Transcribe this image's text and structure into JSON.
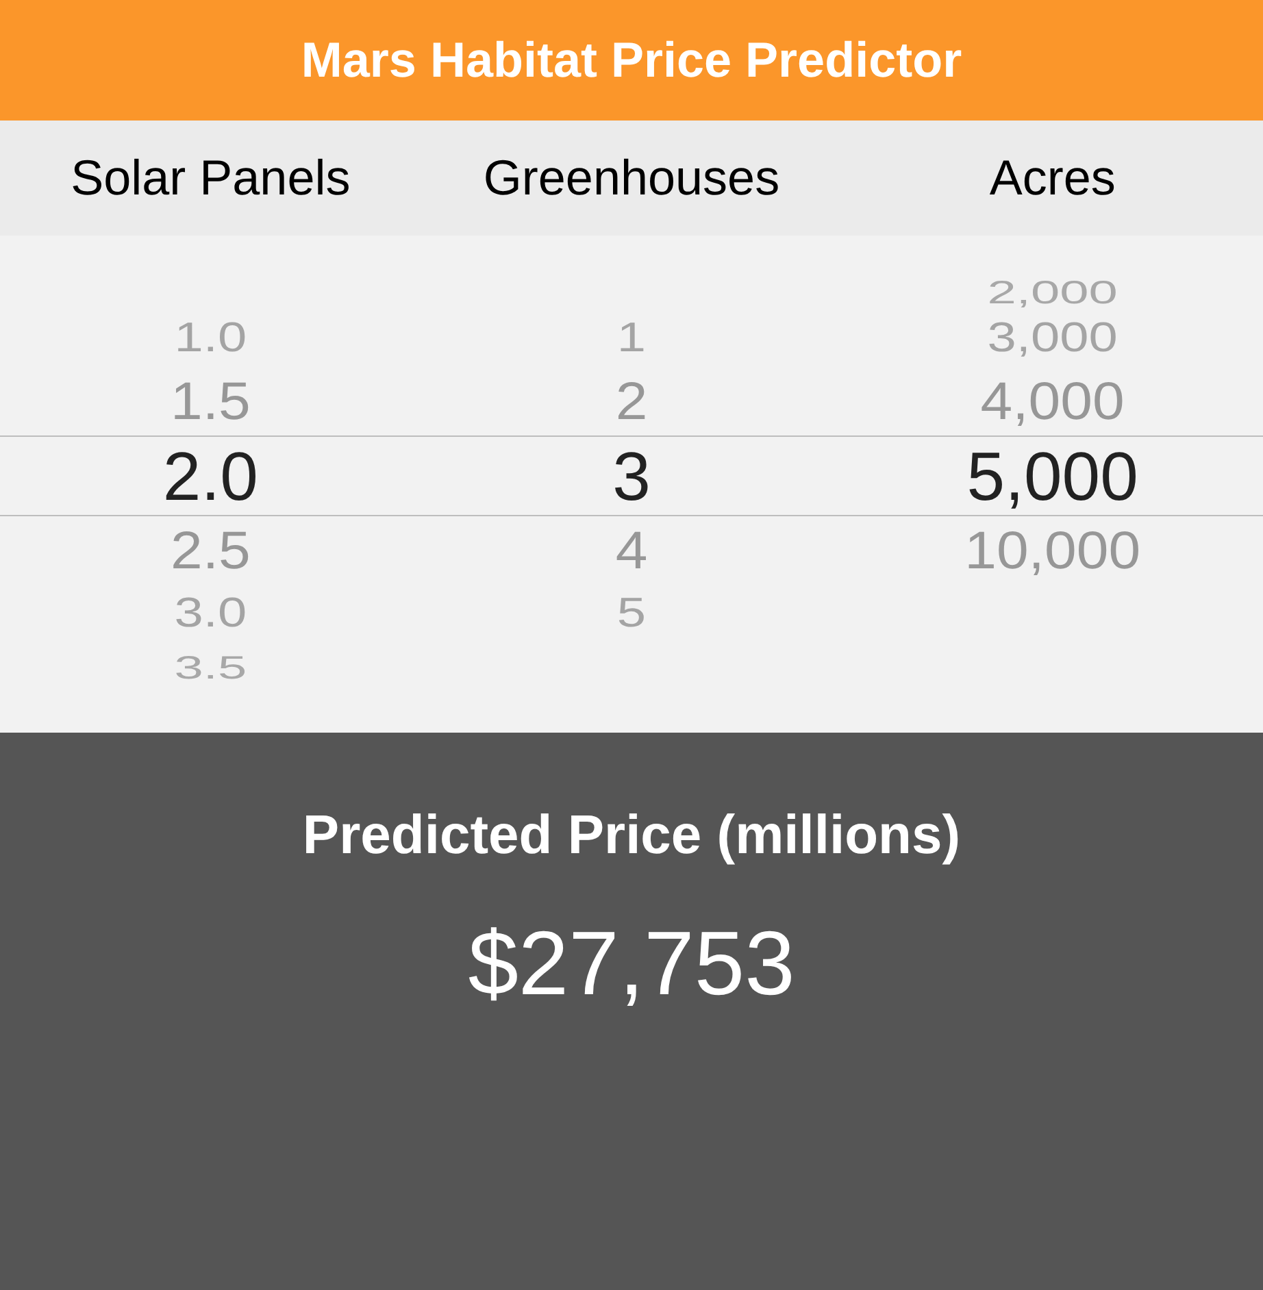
{
  "header": {
    "title": "Mars Habitat Price Predictor"
  },
  "picker": {
    "columns": [
      {
        "label": "Solar Panels",
        "items": [
          {
            "value": "1.0",
            "selected": false
          },
          {
            "value": "1.5",
            "selected": false
          },
          {
            "value": "2.0",
            "selected": true
          },
          {
            "value": "2.5",
            "selected": false
          },
          {
            "value": "3.0",
            "selected": false
          },
          {
            "value": "3.5",
            "selected": false
          }
        ]
      },
      {
        "label": "Greenhouses",
        "items": [
          {
            "value": "1",
            "selected": false
          },
          {
            "value": "2",
            "selected": false
          },
          {
            "value": "3",
            "selected": true
          },
          {
            "value": "4",
            "selected": false
          },
          {
            "value": "5",
            "selected": false
          }
        ]
      },
      {
        "label": "Acres",
        "items": [
          {
            "value": "2,000",
            "selected": false
          },
          {
            "value": "3,000",
            "selected": false
          },
          {
            "value": "4,000",
            "selected": false
          },
          {
            "value": "5,000",
            "selected": true
          },
          {
            "value": "10,000",
            "selected": false
          }
        ]
      }
    ]
  },
  "result": {
    "label": "Predicted Price (millions)",
    "value": "$27,753"
  }
}
